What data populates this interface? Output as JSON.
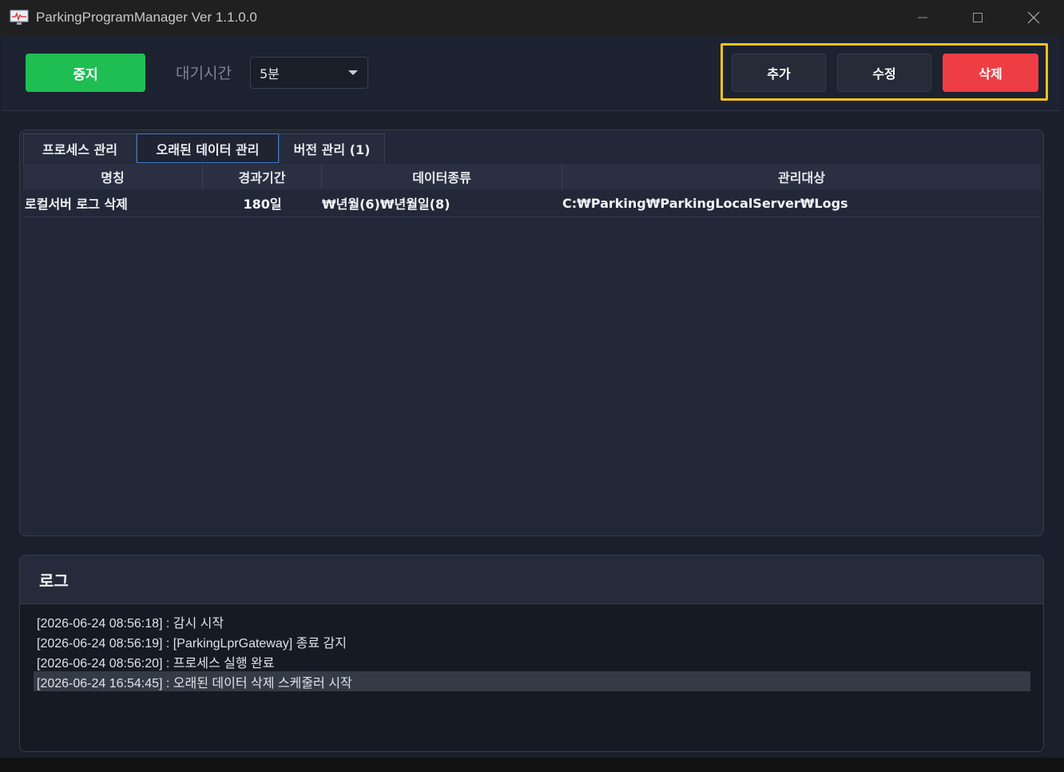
{
  "window": {
    "title": "ParkingProgramManager Ver 1.1.0.0"
  },
  "toolbar": {
    "stop_label": "중지",
    "wait_label": "대기시간",
    "wait_value": "5분",
    "add_label": "추가",
    "edit_label": "수정",
    "delete_label": "삭제"
  },
  "tabs": [
    {
      "label": "프로세스 관리"
    },
    {
      "label": "오래된 데이터 관리"
    },
    {
      "label": "버전 관리 (1)"
    }
  ],
  "grid": {
    "columns": [
      "명칭",
      "경과기간",
      "데이터종류",
      "관리대상"
    ],
    "rows": [
      [
        "로컬서버 로그 삭제",
        "180일",
        "₩년월(6)₩년월일(8)",
        "C:₩Parking₩ParkingLocalServer₩Logs"
      ]
    ]
  },
  "log": {
    "title": "로그",
    "lines": [
      "[2026-06-24 08:56:18] : 감시 시작",
      "[2026-06-24 08:56:19] : [ParkingLprGateway] 종료 감지",
      "[2026-06-24 08:56:20] : 프로세스 실행 완료",
      "[2026-06-24 16:54:45] : 오래된 데이터 삭제 스케줄러 시작"
    ]
  },
  "colors": {
    "accent_green": "#1fbe53",
    "danger_red": "#ee3d43",
    "highlight_yellow": "#f2c21a",
    "background": "#1b1f2b"
  },
  "icons": [
    "app-monitor-icon",
    "minimize-icon",
    "maximize-icon",
    "close-icon",
    "chevron-down-icon"
  ]
}
